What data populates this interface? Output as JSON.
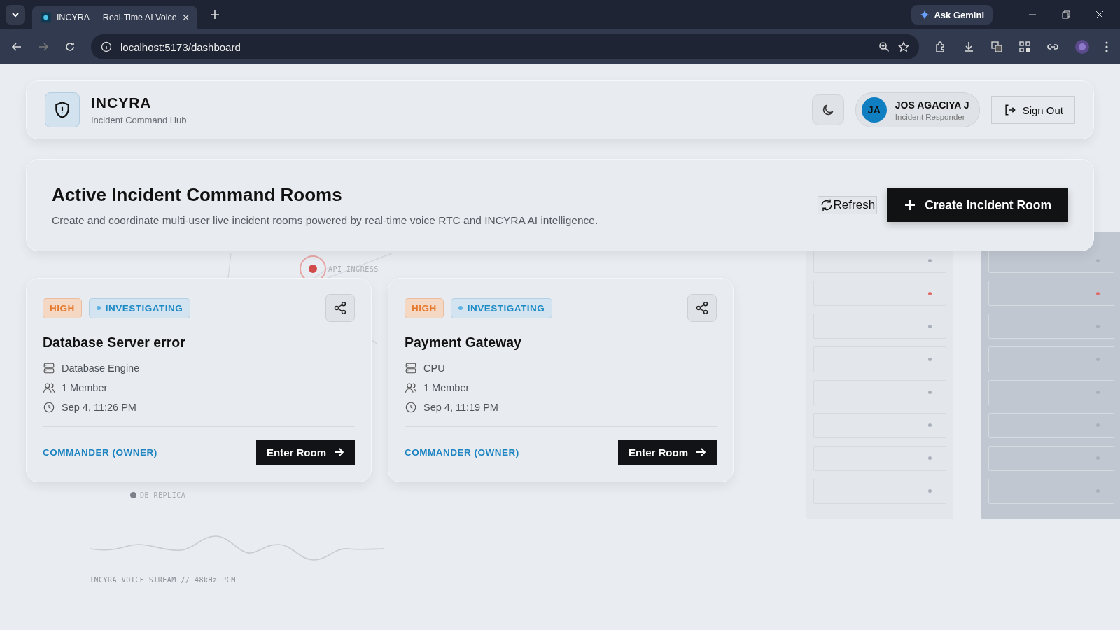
{
  "browser": {
    "tab_title": "INCYRA — Real-Time AI Voice",
    "url": "localhost:5173/dashboard",
    "ask_label": "Ask Gemini"
  },
  "header": {
    "brand": "INCYRA",
    "subtitle": "Incident Command Hub",
    "user": {
      "initials": "JA",
      "name": "JOS AGACIYA J",
      "role": "Incident Responder"
    },
    "sign_out": "Sign Out"
  },
  "hero": {
    "title": "Active Incident Command Rooms",
    "description": "Create and coordinate multi-user live incident rooms powered by real-time voice RTC and INCYRA AI intelligence.",
    "refresh": "Refresh",
    "create": "Create Incident Room"
  },
  "rooms": [
    {
      "severity": "HIGH",
      "status": "INVESTIGATING",
      "title": "Database Server error",
      "service": "Database Engine",
      "members": "1 Member",
      "time": "Sep 4, 11:26 PM",
      "role": "COMMANDER (OWNER)",
      "action": "Enter Room"
    },
    {
      "severity": "HIGH",
      "status": "INVESTIGATING",
      "title": "Payment Gateway",
      "service": "CPU",
      "members": "1 Member",
      "time": "Sep 4, 11:19 PM",
      "role": "COMMANDER (OWNER)",
      "action": "Enter Room"
    }
  ],
  "backdrop": {
    "ingress_label": "API INGRESS",
    "replica_label": "DB REPLICA",
    "stream_label": "INCYRA VOICE STREAM // 48kHz PCM",
    "racks": [
      {
        "kind": "light",
        "slots": [
          {
            "alert": false
          },
          {
            "alert": true
          },
          {
            "alert": false
          },
          {
            "alert": false
          },
          {
            "alert": false
          },
          {
            "alert": false
          },
          {
            "alert": false
          },
          {
            "alert": false
          }
        ]
      },
      {
        "kind": "dark",
        "slots": [
          {
            "alert": false
          },
          {
            "alert": true
          },
          {
            "alert": false
          },
          {
            "alert": false
          },
          {
            "alert": false
          },
          {
            "alert": false
          },
          {
            "alert": false
          },
          {
            "alert": false
          }
        ]
      }
    ]
  }
}
